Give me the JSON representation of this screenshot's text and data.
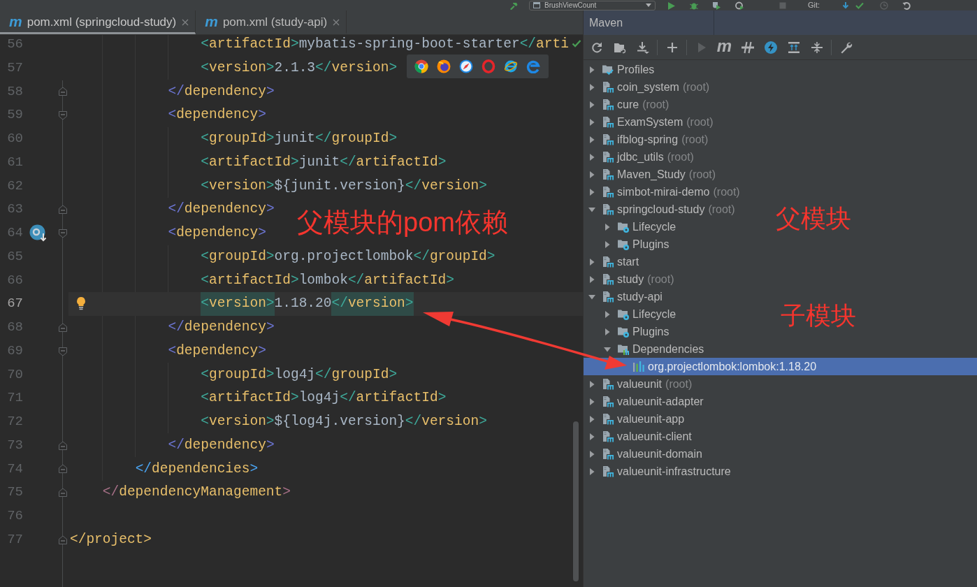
{
  "toolbar": [
    {
      "kind": "build",
      "disabled": false
    },
    {
      "kind": "run-config",
      "label": "BrushViewCount",
      "disabled": false
    },
    {
      "kind": "run",
      "disabled": false
    },
    {
      "kind": "debug",
      "disabled": false
    },
    {
      "kind": "coverage",
      "disabled": false
    },
    {
      "kind": "profile",
      "disabled": false
    },
    {
      "kind": "stop",
      "disabled": true
    },
    {
      "kind": "vcs-label",
      "label": "Git:",
      "disabled": false
    },
    {
      "kind": "update",
      "disabled": false
    },
    {
      "kind": "commit",
      "disabled": false
    },
    {
      "kind": "history",
      "disabled": true
    },
    {
      "kind": "rollback",
      "disabled": false
    }
  ],
  "editor": {
    "tabs": [
      {
        "glyph": "m",
        "label": "pom.xml (springcloud-study)",
        "selected": true
      },
      {
        "glyph": "m",
        "label": "pom.xml (study-api)",
        "selected": false
      }
    ],
    "lines": [
      {
        "number": "56",
        "code": "                <artifactId>mybatis-spring-boot-starter</arti",
        "color": "#3ea99a",
        "current": false
      },
      {
        "number": "57",
        "code": "                <version>2.1.3</version>",
        "color": "#3ea99a",
        "current": false
      },
      {
        "number": "58",
        "code": "            </dependency>",
        "color": "#6c75d2",
        "gutter": [
          {
            "kind": "fold-end"
          }
        ],
        "current": false
      },
      {
        "number": "59",
        "code": "            <dependency>",
        "color": "#6c75d2",
        "gutter": [
          {
            "kind": "fold-start"
          }
        ],
        "current": false
      },
      {
        "number": "60",
        "code": "                <groupId>junit</groupId>",
        "color": "#3ea99a",
        "current": false
      },
      {
        "number": "61",
        "code": "                <artifactId>junit</artifactId>",
        "color": "#3ea99a",
        "current": false
      },
      {
        "number": "62",
        "code": "                <version>${junit.version}</version>",
        "color": "#3ea99a",
        "current": false
      },
      {
        "number": "63",
        "code": "            </dependency>",
        "color": "#6c75d2",
        "gutter": [
          {
            "kind": "fold-end"
          }
        ],
        "current": false
      },
      {
        "number": "64",
        "code": "            <dependency>",
        "color": "#6c75d2",
        "gutter": [
          {
            "kind": "badge"
          },
          {
            "kind": "fold-start"
          }
        ],
        "current": false
      },
      {
        "number": "65",
        "code": "                <groupId>org.projectlombok</groupId>",
        "color": "#3ea99a",
        "current": false
      },
      {
        "number": "66",
        "code": "                <artifactId>lombok</artifactId>",
        "color": "#3ea99a",
        "current": false
      },
      {
        "number": "67",
        "code": "                <version>1.18.20</version>",
        "color": "#3ea99a",
        "gutter": [
          {
            "kind": "bulb"
          }
        ],
        "current": true
      },
      {
        "number": "68",
        "code": "            </dependency>",
        "color": "#6c75d2",
        "gutter": [
          {
            "kind": "fold-end"
          }
        ],
        "current": false
      },
      {
        "number": "69",
        "code": "            <dependency>",
        "color": "#6c75d2",
        "gutter": [
          {
            "kind": "fold-start"
          }
        ],
        "current": false
      },
      {
        "number": "70",
        "code": "                <groupId>log4j</groupId>",
        "color": "#3ea99a",
        "current": false
      },
      {
        "number": "71",
        "code": "                <artifactId>log4j</artifactId>",
        "color": "#3ea99a",
        "current": false
      },
      {
        "number": "72",
        "code": "                <version>${log4j.version}</version>",
        "color": "#3ea99a",
        "current": false
      },
      {
        "number": "73",
        "code": "            </dependency>",
        "color": "#6c75d2",
        "gutter": [
          {
            "kind": "fold-end"
          }
        ],
        "current": false
      },
      {
        "number": "74",
        "code": "        </dependencies>",
        "color": "#4aa3f0",
        "gutter": [
          {
            "kind": "fold-end"
          }
        ],
        "current": false
      },
      {
        "number": "75",
        "code": "    </dependencyManagement>",
        "color": "#a56f86",
        "gutter": [
          {
            "kind": "fold-end"
          }
        ],
        "current": false
      },
      {
        "number": "76",
        "current": false
      },
      {
        "number": "77",
        "code": "</project>",
        "color": "#e8bf6a",
        "gutter": [
          {
            "kind": "fold-end"
          }
        ],
        "current": false
      }
    ]
  },
  "maven": {
    "title": "Maven",
    "toolbar": [
      {
        "kind": "reload",
        "disabled": false
      },
      {
        "kind": "generate",
        "disabled": false
      },
      {
        "kind": "download",
        "disabled": false
      },
      {
        "kind": "separator"
      },
      {
        "kind": "add",
        "disabled": false
      },
      {
        "kind": "separator"
      },
      {
        "kind": "run",
        "disabled": true
      },
      {
        "kind": "goal",
        "glyph": "m",
        "disabled": false
      },
      {
        "kind": "skip-tests",
        "disabled": false
      },
      {
        "kind": "offline",
        "disabled": false
      },
      {
        "kind": "expand-all",
        "disabled": false
      },
      {
        "kind": "collapse-all",
        "disabled": false
      },
      {
        "kind": "separator"
      },
      {
        "kind": "settings",
        "disabled": false
      }
    ],
    "tree": [
      {
        "label": "Profiles",
        "kind": "profiles",
        "expanded": false,
        "selected": false
      },
      {
        "label": "coin_system",
        "suffix": "(root)",
        "kind": "module",
        "expanded": false,
        "selected": false
      },
      {
        "label": "cure",
        "suffix": "(root)",
        "kind": "module",
        "expanded": false,
        "selected": false
      },
      {
        "label": "ExamSystem",
        "suffix": "(root)",
        "kind": "module",
        "expanded": false,
        "selected": false
      },
      {
        "label": "ifblog-spring",
        "suffix": "(root)",
        "kind": "module",
        "expanded": false,
        "selected": false
      },
      {
        "label": "jdbc_utils",
        "suffix": "(root)",
        "kind": "module",
        "expanded": false,
        "selected": false
      },
      {
        "label": "Maven_Study",
        "suffix": "(root)",
        "kind": "module",
        "expanded": false,
        "selected": false
      },
      {
        "label": "simbot-mirai-demo",
        "suffix": "(root)",
        "kind": "module",
        "expanded": false,
        "selected": false
      },
      {
        "label": "springcloud-study",
        "suffix": "(root)",
        "kind": "module",
        "expanded": true,
        "selected": false,
        "children": [
          {
            "label": "Lifecycle",
            "kind": "lifecycle",
            "expanded": false,
            "selected": false
          },
          {
            "label": "Plugins",
            "kind": "plugins",
            "expanded": false,
            "selected": false
          }
        ]
      },
      {
        "label": "start",
        "kind": "module",
        "expanded": false,
        "selected": false
      },
      {
        "label": "study",
        "suffix": "(root)",
        "kind": "module",
        "expanded": false,
        "selected": false
      },
      {
        "label": "study-api",
        "kind": "module",
        "expanded": true,
        "selected": false,
        "children": [
          {
            "label": "Lifecycle",
            "kind": "lifecycle",
            "expanded": false,
            "selected": false
          },
          {
            "label": "Plugins",
            "kind": "plugins",
            "expanded": false,
            "selected": false
          },
          {
            "label": "Dependencies",
            "kind": "dependencies",
            "expanded": true,
            "selected": false,
            "children": [
              {
                "label": "org.projectlombok:lombok:1.18.20",
                "kind": "dependency",
                "selected": true
              }
            ]
          }
        ]
      },
      {
        "label": "valueunit",
        "suffix": "(root)",
        "kind": "module",
        "expanded": false,
        "selected": false
      },
      {
        "label": "valueunit-adapter",
        "kind": "module",
        "expanded": false,
        "selected": false
      },
      {
        "label": "valueunit-app",
        "kind": "module",
        "expanded": false,
        "selected": false
      },
      {
        "label": "valueunit-client",
        "kind": "module",
        "expanded": false,
        "selected": false
      },
      {
        "label": "valueunit-domain",
        "kind": "module",
        "expanded": false,
        "selected": false
      },
      {
        "label": "valueunit-infrastructure",
        "kind": "module",
        "expanded": false,
        "selected": false
      }
    ]
  },
  "annotations": [
    {
      "text": "父模块的pom依赖"
    },
    {
      "text": "父模块"
    },
    {
      "text": "子模块"
    }
  ]
}
